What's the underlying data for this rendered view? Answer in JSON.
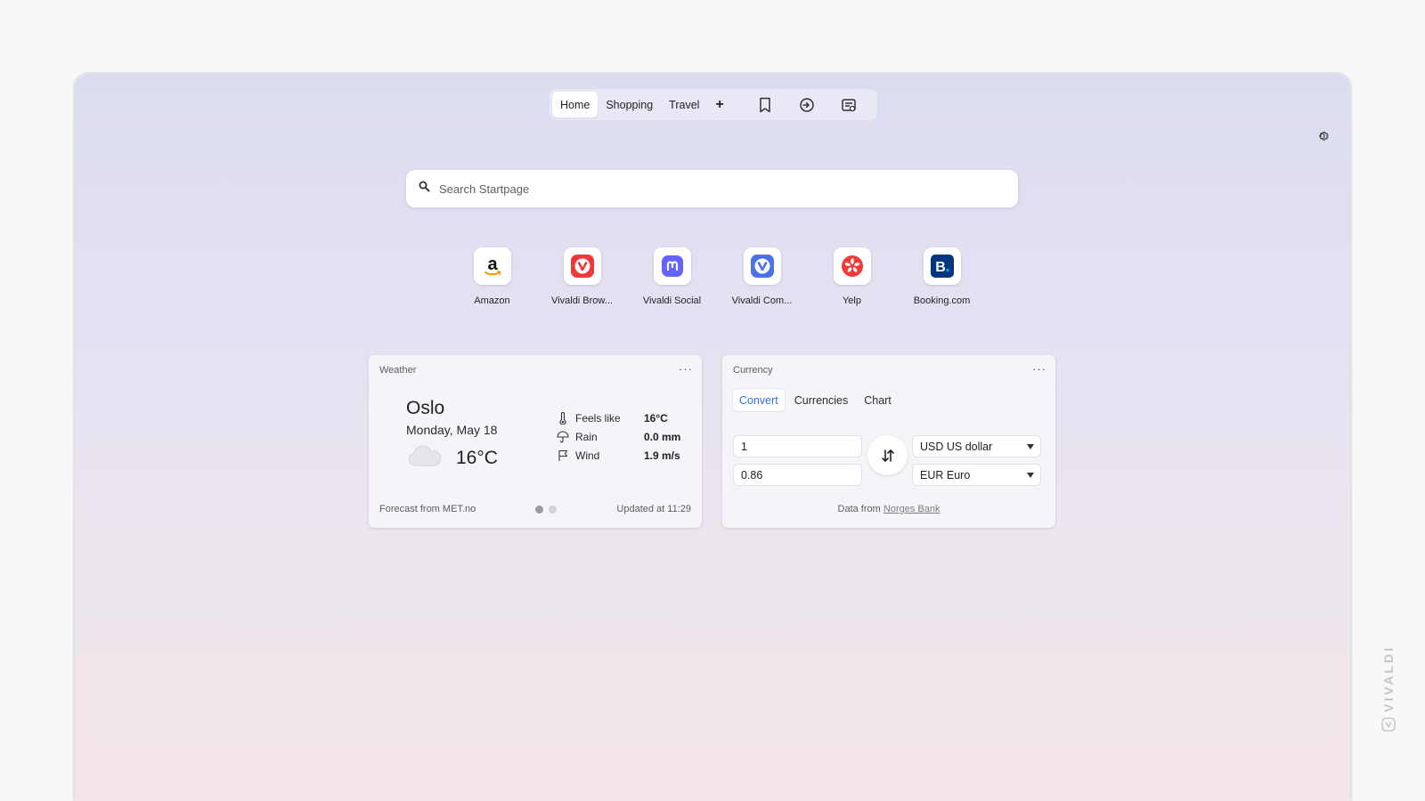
{
  "tabs": [
    {
      "label": "Home",
      "active": true
    },
    {
      "label": "Shopping",
      "active": false
    },
    {
      "label": "Travel",
      "active": false
    }
  ],
  "tab_add": "+",
  "toolbar_icons": [
    "bookmark-icon",
    "history-icon",
    "notes-icon"
  ],
  "search": {
    "placeholder": "Search Startpage"
  },
  "speed_dials": [
    {
      "label": "Amazon",
      "icon": "amazon-logo"
    },
    {
      "label": "Vivaldi Brow...",
      "icon": "vivaldi-logo"
    },
    {
      "label": "Vivaldi Social",
      "icon": "mastodon-logo"
    },
    {
      "label": "Vivaldi Com...",
      "icon": "vivaldi-community-logo"
    },
    {
      "label": "Yelp",
      "icon": "yelp-logo"
    },
    {
      "label": "Booking.com",
      "icon": "booking-logo"
    }
  ],
  "weather": {
    "title": "Weather",
    "city": "Oslo",
    "date": "Monday, May 18",
    "temp": "16°C",
    "details": [
      {
        "label": "Feels like",
        "value": "16°C",
        "icon": "thermometer-icon"
      },
      {
        "label": "Rain",
        "value": "0.0 mm",
        "icon": "umbrella-icon"
      },
      {
        "label": "Wind",
        "value": "1.9 m/s",
        "icon": "flag-icon"
      }
    ],
    "forecast_source": "Forecast from MET.no",
    "updated": "Updated at 11:29"
  },
  "currency": {
    "title": "Currency",
    "tabs": [
      {
        "label": "Convert",
        "active": true
      },
      {
        "label": "Currencies",
        "active": false
      },
      {
        "label": "Chart",
        "active": false
      }
    ],
    "from_amount": "1",
    "to_amount": "0.86",
    "from_currency": "USD US dollar",
    "to_currency": "EUR Euro",
    "data_prefix": "Data from",
    "data_source": "Norges Bank"
  },
  "brand": "VIVALDI",
  "colors": {
    "accent": "#3b6fd8",
    "vivaldi_red": "#ef3939",
    "mastodon": "#6364ff",
    "yelp": "#f43939",
    "booking": "#003580"
  }
}
